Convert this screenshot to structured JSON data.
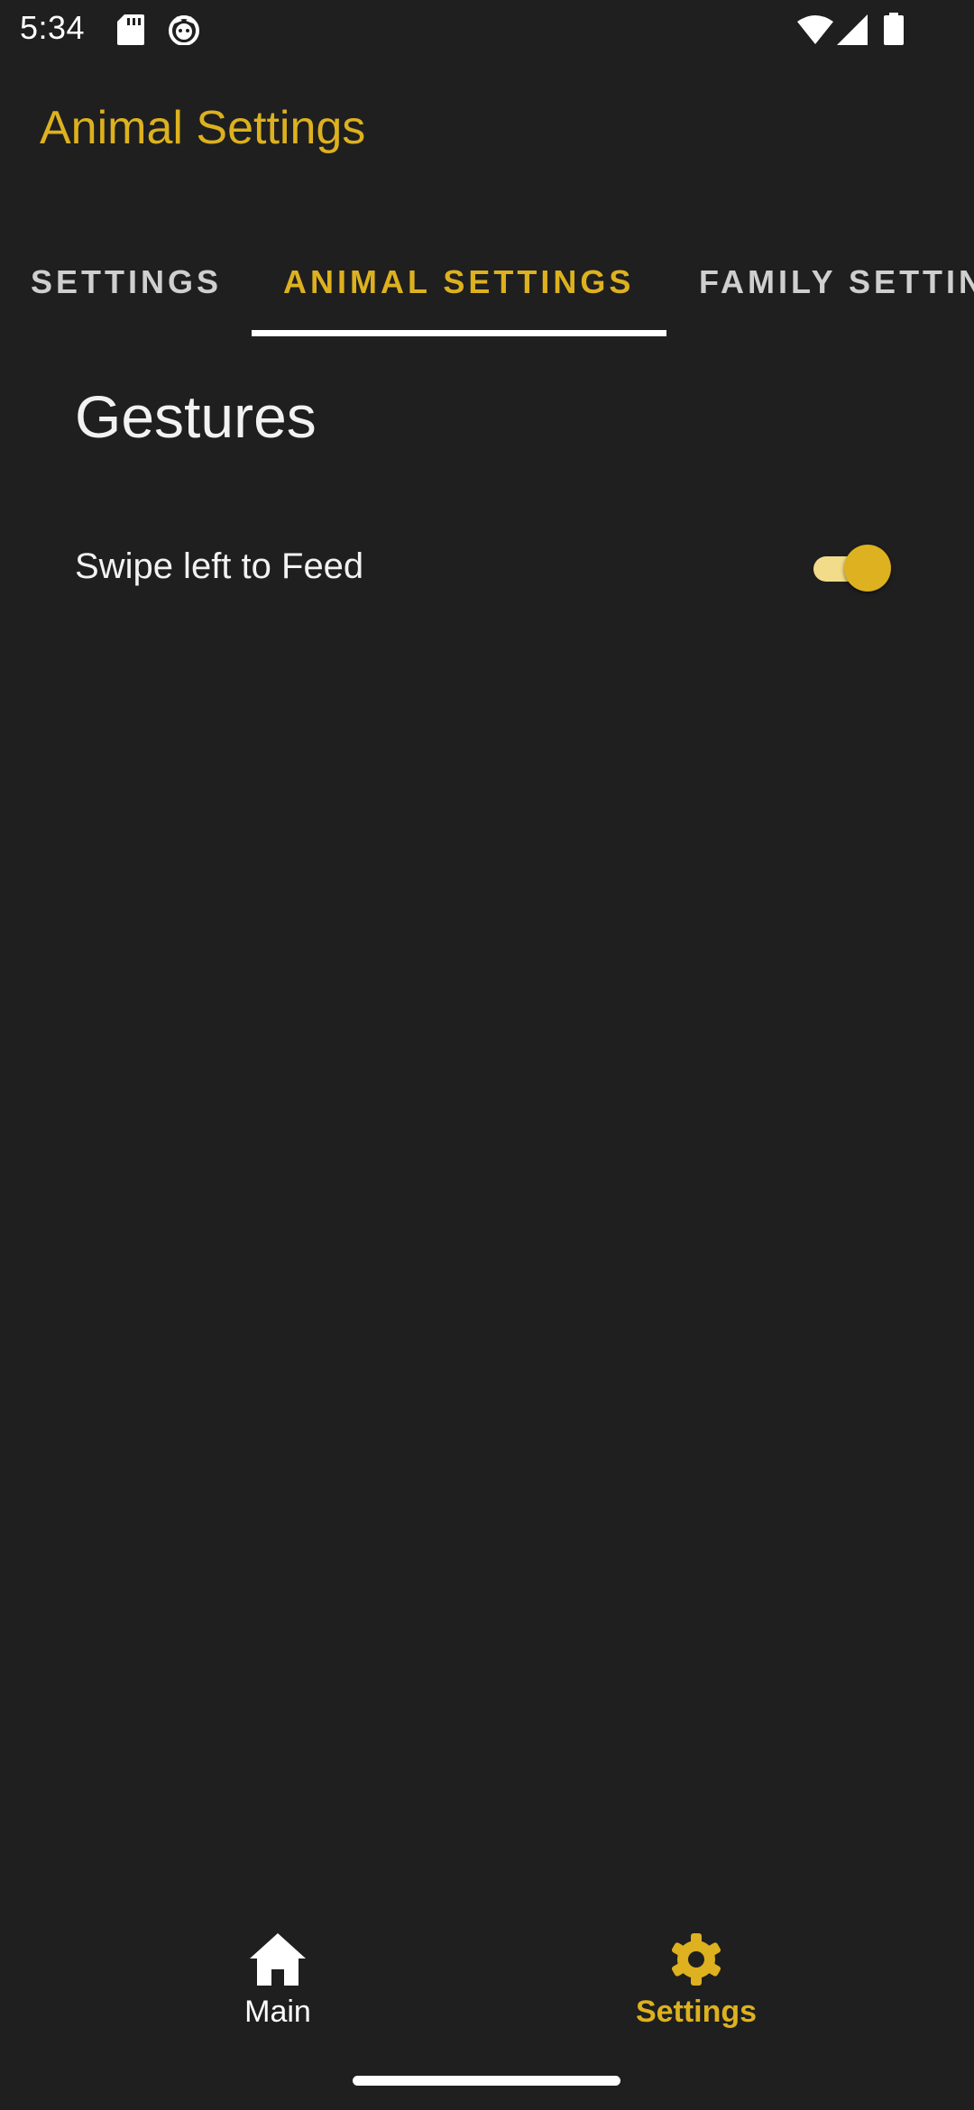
{
  "status_bar": {
    "time": "5:34",
    "icons": [
      "sd-card-icon",
      "cat-notification-icon",
      "wifi-icon",
      "cell-signal-icon",
      "battery-icon"
    ]
  },
  "toolbar": {
    "title": "Animal Settings"
  },
  "tabs": [
    {
      "label": "SETTINGS",
      "selected": false
    },
    {
      "label": "ANIMAL SETTINGS",
      "selected": true
    },
    {
      "label": "FAMILY SETTIN",
      "selected": false
    }
  ],
  "content": {
    "section_title": "Gestures",
    "preferences": [
      {
        "label": "Swipe left to Feed",
        "enabled": true
      }
    ]
  },
  "bottom_nav": {
    "items": [
      {
        "label": "Main",
        "icon": "home-icon",
        "selected": false
      },
      {
        "label": "Settings",
        "icon": "gear-icon",
        "selected": true
      }
    ]
  },
  "colors": {
    "background": "#1f1f1f",
    "accent": "#ddb11f",
    "switch_track": "#f2dc8a",
    "text": "#f2f2f2"
  }
}
